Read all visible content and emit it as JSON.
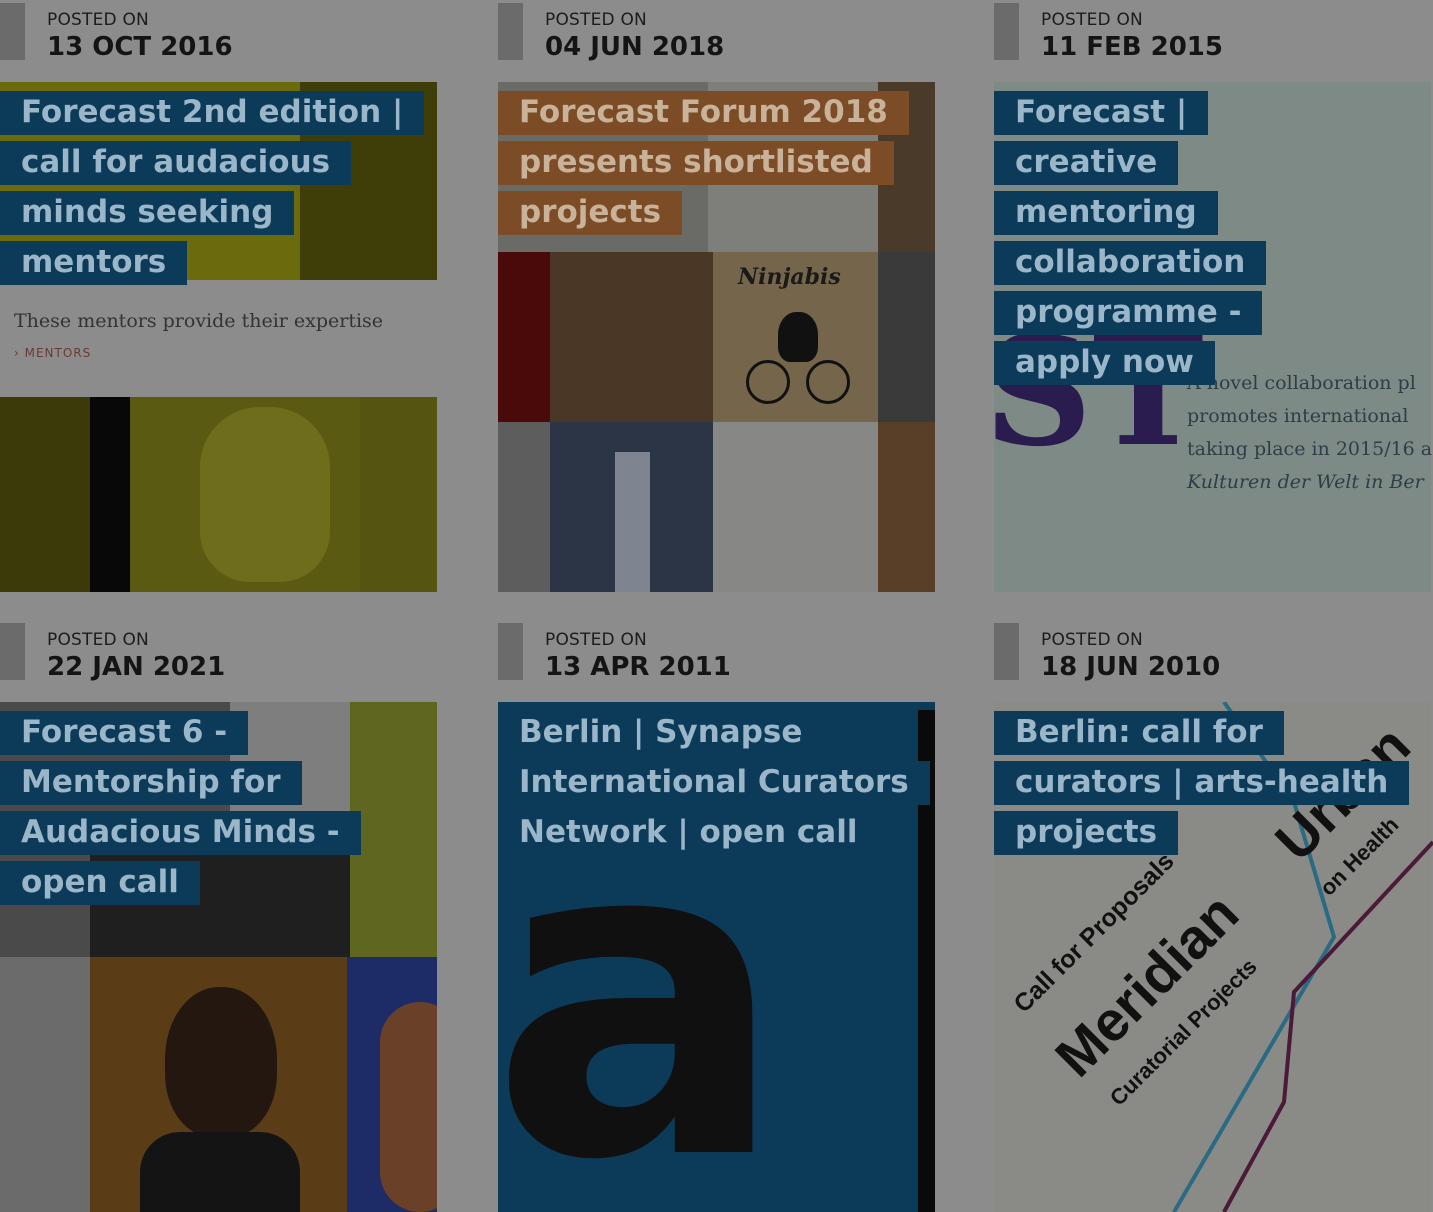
{
  "posts": [
    {
      "posted_label": "POSTED ON",
      "date": "13 OCT 2016",
      "headline": "Forecast 2nd edition | call for audacious minds seeking mentors",
      "thumb_text": "These mentors provide their expertise",
      "thumb_link": "› MENTORS"
    },
    {
      "posted_label": "POSTED ON",
      "date": "04 JUN 2018",
      "headline": "Forecast Forum 2018 presents shortlisted projects",
      "thumb_text": "Ninjabis"
    },
    {
      "posted_label": "POSTED ON",
      "date": "11 FEB 2015",
      "headline": "Forecast | creative mentoring collaboration programme - apply now",
      "thumb_lines": [
        "A novel collaboration pl",
        "promotes international",
        "taking place in 2015/16 a",
        "Kulturen der Welt in Ber"
      ]
    },
    {
      "posted_label": "POSTED ON",
      "date": "22 JAN 2021",
      "headline": "Forecast 6 - Mentorship for Audacious Minds - open call"
    },
    {
      "posted_label": "POSTED ON",
      "date": "13 APR 2011",
      "headline": "Berlin | Synapse International Curators Network | open call",
      "thumb_glyph": "a"
    },
    {
      "posted_label": "POSTED ON",
      "date": "18 JUN 2010",
      "headline": "Berlin: call for curators | arts-health projects",
      "thumb_text_1": "Call for Proposals",
      "thumb_text_2": "Meridian",
      "thumb_text_3": "Curatorial Projects",
      "thumb_text_4": "Urban",
      "thumb_text_5": "on Health"
    }
  ],
  "colors": {
    "overlay_bg": "#8c8c8c",
    "headline_bg": "#0b3b58",
    "headline_text": "#9cb6c9",
    "headline_bg_alt": "#7c4c26"
  }
}
